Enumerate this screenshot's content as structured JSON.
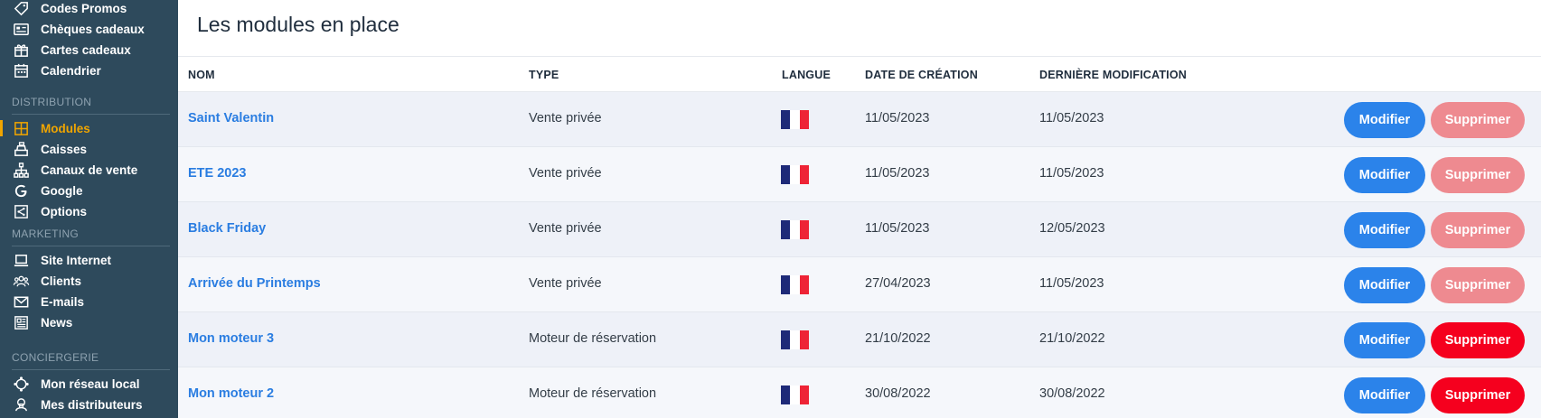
{
  "colors": {
    "sidebar_bg": "#2e4a5c",
    "active": "#f0a500",
    "link": "#2a7de1",
    "modify": "#2b83ea",
    "delete_enabled": "#f5001e",
    "delete_disabled": "#ee8a90",
    "flag_blue": "#1e2a78",
    "flag_white": "#ffffff",
    "flag_red": "#ee2436"
  },
  "sidebar": {
    "top_items": [
      {
        "label": "Codes Promos",
        "icon": "tag-icon"
      },
      {
        "label": "Chèques cadeaux",
        "icon": "gift-card-icon"
      },
      {
        "label": "Cartes cadeaux",
        "icon": "gift-icon"
      },
      {
        "label": "Calendrier",
        "icon": "calendar-icon"
      }
    ],
    "sections": [
      {
        "title": "DISTRIBUTION",
        "items": [
          {
            "label": "Modules",
            "icon": "grid-icon",
            "active": true
          },
          {
            "label": "Caisses",
            "icon": "cash-register-icon"
          },
          {
            "label": "Canaux de vente",
            "icon": "sitemap-icon"
          },
          {
            "label": "Google",
            "icon": "google-icon"
          },
          {
            "label": "Options",
            "icon": "share-icon"
          }
        ]
      },
      {
        "title": "MARKETING",
        "items": [
          {
            "label": "Site Internet",
            "icon": "laptop-icon"
          },
          {
            "label": "Clients",
            "icon": "users-icon"
          },
          {
            "label": "E-mails",
            "icon": "envelope-icon"
          },
          {
            "label": "News",
            "icon": "newspaper-icon"
          }
        ]
      },
      {
        "title": "CONCIERGERIE",
        "items": [
          {
            "label": "Mon réseau local",
            "icon": "network-icon"
          },
          {
            "label": "Mes distributeurs",
            "icon": "distributor-icon"
          }
        ]
      }
    ]
  },
  "main": {
    "title": "Les modules en place",
    "columns": {
      "name": "NOM",
      "type": "TYPE",
      "language": "LANGUE",
      "created": "DATE DE CRÉATION",
      "modified": "DERNIÈRE MODIFICATION"
    },
    "buttons": {
      "modify": "Modifier",
      "delete": "Supprimer"
    },
    "rows": [
      {
        "name": "Saint Valentin",
        "type": "Vente privée",
        "language": "fr",
        "created": "11/05/2023",
        "modified": "11/05/2023",
        "delete_enabled": false
      },
      {
        "name": "ETE 2023",
        "type": "Vente privée",
        "language": "fr",
        "created": "11/05/2023",
        "modified": "11/05/2023",
        "delete_enabled": false
      },
      {
        "name": "Black Friday",
        "type": "Vente privée",
        "language": "fr",
        "created": "11/05/2023",
        "modified": "12/05/2023",
        "delete_enabled": false
      },
      {
        "name": "Arrivée du Printemps",
        "type": "Vente privée",
        "language": "fr",
        "created": "27/04/2023",
        "modified": "11/05/2023",
        "delete_enabled": false
      },
      {
        "name": "Mon moteur 3",
        "type": "Moteur de réservation",
        "language": "fr",
        "created": "21/10/2022",
        "modified": "21/10/2022",
        "delete_enabled": true
      },
      {
        "name": "Mon moteur 2",
        "type": "Moteur de réservation",
        "language": "fr",
        "created": "30/08/2022",
        "modified": "30/08/2022",
        "delete_enabled": true
      }
    ]
  }
}
